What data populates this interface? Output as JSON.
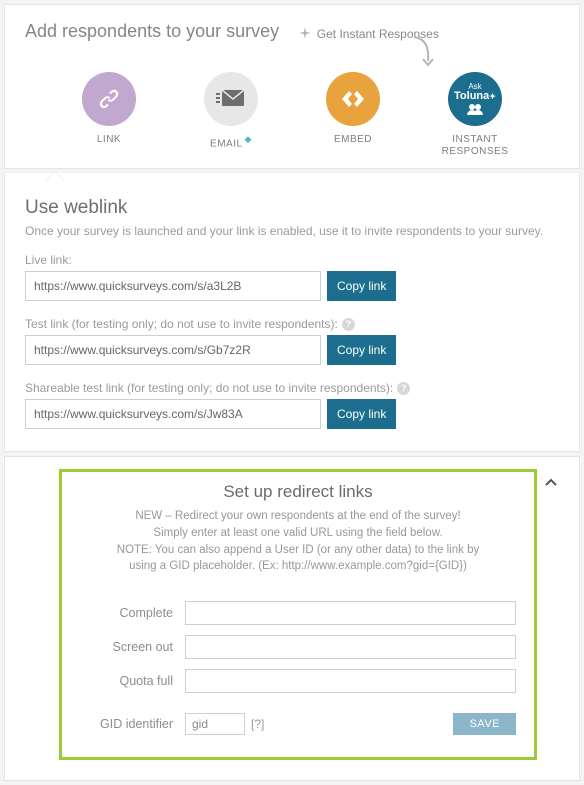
{
  "header": {
    "title": "Add respondents to your survey",
    "instant_link": "Get Instant Responses"
  },
  "methods": {
    "link": {
      "label": "LINK"
    },
    "email": {
      "label": "EMAIL"
    },
    "embed": {
      "label": "EMBED"
    },
    "instant": {
      "label": "INSTANT RESPONSES",
      "logo_line1": "Ask",
      "logo_line2": "Toluna"
    }
  },
  "weblink": {
    "title": "Use weblink",
    "subtitle": "Once your survey is launched and your link is enabled, use it to invite respondents to your survey.",
    "live_label": "Live link:",
    "live_value": "https://www.quicksurveys.com/s/a3L2B",
    "test_label": "Test link (for testing only; do not use to invite respondents):",
    "test_value": "https://www.quicksurveys.com/s/Gb7z2R",
    "share_label": "Shareable test link (for testing only; do not use to invite respondents):",
    "share_value": "https://www.quicksurveys.com/s/Jw83A",
    "copy_label": "Copy link"
  },
  "redirect": {
    "title": "Set up redirect links",
    "desc_line1": "NEW – Redirect your own respondents at the end of the survey!",
    "desc_line2": "Simply enter at least one valid URL using the field below.",
    "desc_line3": "NOTE: You can also append a User ID (or any other data) to the link by",
    "desc_line4": "using a GID placeholder. (Ex: http://www.example.com?gid={GID})",
    "complete_label": "Complete",
    "screenout_label": "Screen out",
    "quotafull_label": "Quota full",
    "gid_label": "GID identifier",
    "gid_value": "gid",
    "gid_help": "[?]",
    "save_label": "SAVE"
  }
}
